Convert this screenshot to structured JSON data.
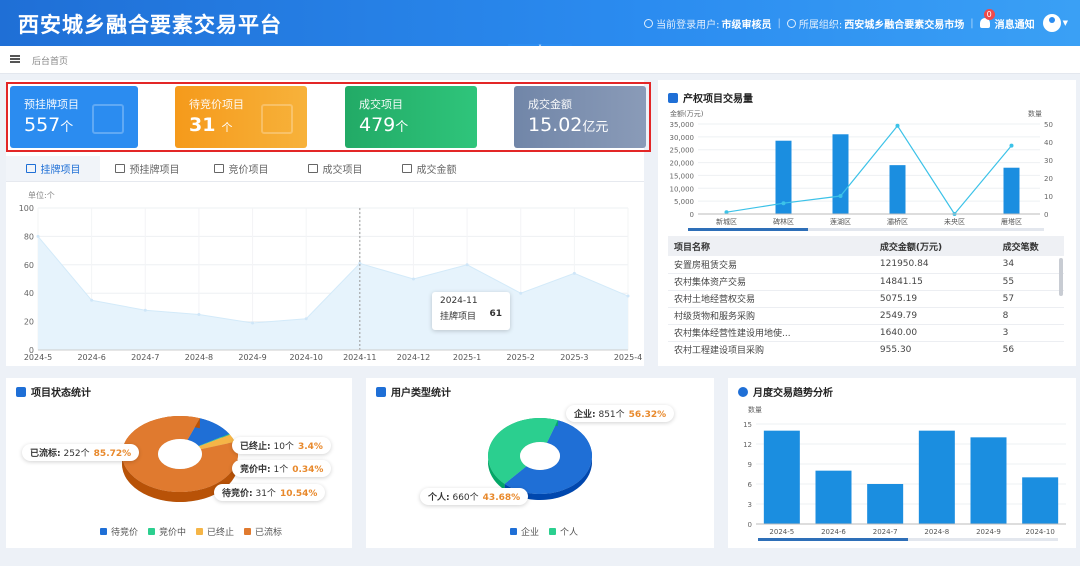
{
  "header": {
    "title": "西安城乡融合要素交易平台",
    "user_label": "当前登录用户:",
    "user_value": "市级审核员",
    "org_label": "所属组织:",
    "org_value": "西安城乡融合要素交易市场",
    "notify_label": "消息通知",
    "notify_count": "0"
  },
  "subbar": {
    "breadcrumb": "后台首页"
  },
  "kpis": [
    {
      "label": "预挂牌项目",
      "value": "557",
      "unit": "个",
      "color": "#2b8cf0"
    },
    {
      "label": "待竞价项目",
      "value": "31",
      "unit": "个",
      "color": "#f5a623"
    },
    {
      "label": "成交项目",
      "value": "479",
      "unit": "个",
      "color": "#2bb673"
    },
    {
      "label": "成交金额",
      "value": "15.02",
      "unit": "亿元",
      "color": "#7d8fae"
    }
  ],
  "tabs": [
    {
      "label": "挂牌项目",
      "icon": "listing-icon"
    },
    {
      "label": "预挂牌项目",
      "icon": "scale-icon"
    },
    {
      "label": "竞价项目",
      "icon": "bid-icon"
    },
    {
      "label": "成交项目",
      "icon": "deal-icon"
    },
    {
      "label": "成交金额",
      "icon": "money-icon"
    }
  ],
  "area_chart": {
    "ylabel": "单位:个",
    "yticks": [
      "0",
      "20",
      "40",
      "60",
      "80",
      "100"
    ],
    "xticks": [
      "2024-5",
      "2024-6",
      "2024-7",
      "2024-8",
      "2024-9",
      "2024-10",
      "2024-11",
      "2024-12",
      "2025-1",
      "2025-2",
      "2025-3",
      "2025-4"
    ],
    "tooltip_title": "2024-11",
    "tooltip_series": "挂牌项目",
    "tooltip_value": "61"
  },
  "property_panel": {
    "title": "产权项目交易量",
    "left_unit": "金额(万元)",
    "right_unit": "数量",
    "left_ticks": [
      "0",
      "5,000",
      "10,000",
      "15,000",
      "20,000",
      "25,000",
      "30,000",
      "35,000"
    ],
    "right_ticks": [
      "0",
      "10",
      "20",
      "30",
      "40",
      "50"
    ],
    "categories": [
      "新城区",
      "碑林区",
      "莲湖区",
      "灞桥区",
      "未央区",
      "雁塔区"
    ],
    "table_headers": [
      "项目名称",
      "成交金额(万元)",
      "成交笔数"
    ],
    "table_rows": [
      [
        "安置房租赁交易",
        "121950.84",
        "34"
      ],
      [
        "农村集体资产交易",
        "14841.15",
        "55"
      ],
      [
        "农村土地经营权交易",
        "5075.19",
        "57"
      ],
      [
        "村级货物和服务采购",
        "2549.79",
        "8"
      ],
      [
        "农村集体经营性建设用地使...",
        "1640.00",
        "3"
      ],
      [
        "农村工程建设项目采购",
        "955.30",
        "56"
      ]
    ]
  },
  "status_panel": {
    "title": "项目状态统计",
    "callouts": [
      {
        "label": "已流标:",
        "count": "252个",
        "pct": "85.72%"
      },
      {
        "label": "已终止:",
        "count": "10个",
        "pct": "3.4%"
      },
      {
        "label": "竞价中:",
        "count": "1个",
        "pct": "0.34%"
      },
      {
        "label": "待竞价:",
        "count": "31个",
        "pct": "10.54%"
      }
    ],
    "legend": [
      "待竞价",
      "竞价中",
      "已终止",
      "已流标"
    ]
  },
  "user_panel": {
    "title": "用户类型统计",
    "callouts": [
      {
        "label": "企业:",
        "count": "851个",
        "pct": "56.32%"
      },
      {
        "label": "个人:",
        "count": "660个",
        "pct": "43.68%"
      }
    ],
    "legend": [
      "企业",
      "个人"
    ]
  },
  "monthly_panel": {
    "title": "月度交易趋势分析",
    "ylabel": "数量",
    "yticks": [
      "0",
      "3",
      "6",
      "9",
      "12",
      "15"
    ]
  },
  "chart_data": [
    {
      "type": "area",
      "title": "",
      "ylabel": "单位:个",
      "ylim": [
        0,
        100
      ],
      "x": [
        "2024-5",
        "2024-6",
        "2024-7",
        "2024-8",
        "2024-9",
        "2024-10",
        "2024-11",
        "2024-12",
        "2025-1",
        "2025-2",
        "2025-3",
        "2025-4"
      ],
      "series": [
        {
          "name": "挂牌项目",
          "values": [
            80,
            35,
            28,
            25,
            19,
            22,
            61,
            50,
            60,
            40,
            54,
            38
          ]
        }
      ]
    },
    {
      "type": "bar",
      "title": "产权项目交易量",
      "categories": [
        "新城区",
        "碑林区",
        "莲湖区",
        "灞桥区",
        "未央区",
        "雁塔区"
      ],
      "ylabel": "金额(万元)",
      "ylim": [
        0,
        35000
      ],
      "y2label": "数量",
      "y2lim": [
        0,
        50
      ],
      "series": [
        {
          "name": "",
          "type": "bar",
          "values": [
            0,
            28500,
            31000,
            19000,
            0,
            18000
          ]
        },
        {
          "name": "",
          "type": "line",
          "axis": "right",
          "values": [
            1,
            6,
            10,
            49,
            0,
            38
          ]
        }
      ]
    },
    {
      "type": "pie",
      "title": "项目状态统计",
      "categories": [
        "待竞价",
        "竞价中",
        "已终止",
        "已流标"
      ],
      "values": [
        31,
        1,
        10,
        252
      ],
      "colors": [
        "#1f6fd6",
        "#2bcf8f",
        "#f5b547",
        "#e07a2f"
      ]
    },
    {
      "type": "pie",
      "title": "用户类型统计",
      "categories": [
        "企业",
        "个人"
      ],
      "values": [
        851,
        660
      ],
      "colors": [
        "#1f6fd6",
        "#2bcf8f"
      ]
    },
    {
      "type": "bar",
      "title": "月度交易趋势分析",
      "ylabel": "数量",
      "ylim": [
        0,
        15
      ],
      "categories": [
        "2024-5",
        "2024-6",
        "2024-7",
        "2024-8",
        "2024-9",
        "2024-10"
      ],
      "values": [
        14,
        8,
        6,
        14,
        13,
        7
      ]
    }
  ]
}
